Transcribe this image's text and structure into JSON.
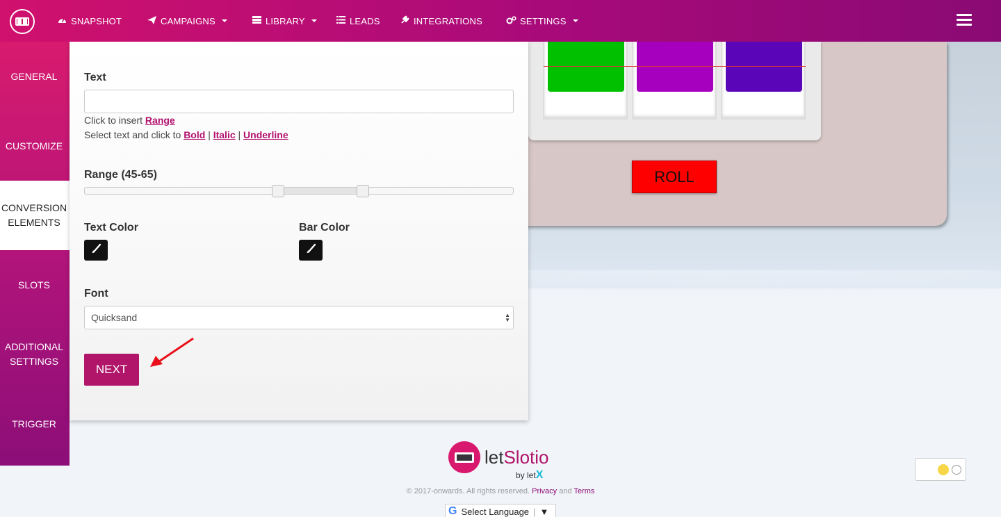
{
  "nav": {
    "items": [
      {
        "label": "SNAPSHOT",
        "icon": "dashboard-icon"
      },
      {
        "label": "CAMPAIGNS",
        "icon": "send-icon",
        "dropdown": true
      },
      {
        "label": "LIBRARY",
        "icon": "library-icon",
        "dropdown": true
      },
      {
        "label": "LEADS",
        "icon": "list-icon"
      },
      {
        "label": "INTEGRATIONS",
        "icon": "plug-icon"
      },
      {
        "label": "SETTINGS",
        "icon": "cogs-icon",
        "dropdown": true
      }
    ]
  },
  "sidebar": {
    "items": [
      {
        "label": "GENERAL"
      },
      {
        "label": "CUSTOMIZE"
      },
      {
        "label": "CONVERSION ELEMENTS",
        "active": true
      },
      {
        "label": "SLOTS"
      },
      {
        "label": "ADDITIONAL SETTINGS"
      },
      {
        "label": "TRIGGER"
      }
    ]
  },
  "form": {
    "text_label": "Text",
    "text_value": "",
    "hint_insert": "Click to insert",
    "hint_range_link": "Range",
    "hint_select": "Select text and click to",
    "bold_link": "Bold",
    "italic_link": "Italic",
    "underline_link": "Underline",
    "separator": "|",
    "range_label": "Range (45-65)",
    "range_min": 45,
    "range_max": 65,
    "text_color_label": "Text Color",
    "text_color": "#111111",
    "bar_color_label": "Bar Color",
    "bar_color": "#111111",
    "font_label": "Font",
    "font_value": "Quicksand",
    "next_label": "NEXT"
  },
  "preview": {
    "roll_label": "ROLL",
    "reel_colors": [
      "#00c000",
      "#a600be",
      "#5a05b8"
    ],
    "roll_color": "#ff0000"
  },
  "footer": {
    "brand_let": "let",
    "brand_slotio": "Slotio",
    "by_text": "by let",
    "by_x": "X",
    "copyright": "© 2017-onwards. All rights reserved.",
    "privacy": "Privacy",
    "and": "and",
    "terms": "Terms",
    "language": "Select Language"
  },
  "colors": {
    "brand_pink": "#d0116d",
    "brand_purple": "#8a0a74",
    "next_button": "#b0156a"
  }
}
